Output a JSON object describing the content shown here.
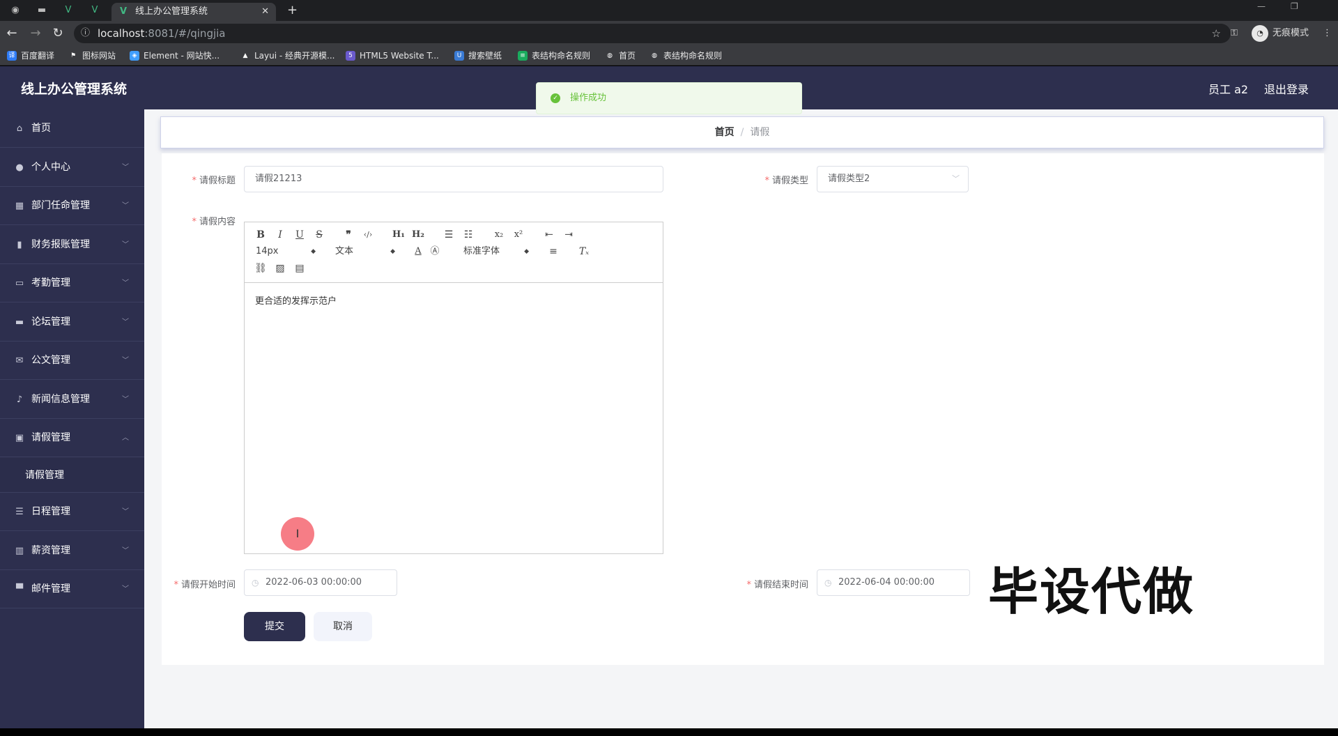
{
  "browser": {
    "tab_title": "线上办公管理系统",
    "new_tab_label": "+",
    "url_host": "localhost",
    "url_path": ":8081/#/qingjia",
    "incognito_label": "无痕模式",
    "bookmarks": [
      "百度翻译",
      "图标网站",
      "Element - 网站快...",
      "Layui - 经典开源模...",
      "HTML5 Website T...",
      "搜索壁纸",
      "表结构命名规则",
      "首页",
      "表结构命名规则"
    ]
  },
  "app": {
    "title": "线上办公管理系统",
    "user": "员工 a2",
    "logout": "退出登录"
  },
  "sidebar": {
    "items": [
      {
        "label": "首页",
        "icon": "home-icon"
      },
      {
        "label": "个人中心",
        "icon": "user-icon"
      },
      {
        "label": "部门任命管理",
        "icon": "grid-icon"
      },
      {
        "label": "财务报账管理",
        "icon": "bar-chart-icon"
      },
      {
        "label": "考勤管理",
        "icon": "message-icon"
      },
      {
        "label": "论坛管理",
        "icon": "ticket-icon"
      },
      {
        "label": "公文管理",
        "icon": "mail-icon"
      },
      {
        "label": "新闻信息管理",
        "icon": "bell-icon"
      },
      {
        "label": "请假管理",
        "icon": "card-icon"
      },
      {
        "label": "日程管理",
        "icon": "list-icon"
      },
      {
        "label": "薪资管理",
        "icon": "stats-icon"
      },
      {
        "label": "邮件管理",
        "icon": "monitor-icon"
      }
    ],
    "submenu": {
      "label": "请假管理"
    }
  },
  "breadcrumb": {
    "home": "首页",
    "separator": "/",
    "current": "请假"
  },
  "toast": {
    "message": "操作成功"
  },
  "form": {
    "title_label": "请假标题",
    "title_value": "请假21213",
    "type_label": "请假类型",
    "type_value": "请假类型2",
    "content_label": "请假内容",
    "content_value": "更合适的发挥示范户",
    "start_label": "请假开始时间",
    "start_value": "2022-06-03 00:00:00",
    "end_label": "请假结束时间",
    "end_value": "2022-06-04 00:00:00",
    "submit": "提交",
    "cancel": "取消"
  },
  "editor_toolbar": {
    "size": "14px",
    "format": "文本",
    "font": "标准字体"
  },
  "watermark": "毕设代做"
}
